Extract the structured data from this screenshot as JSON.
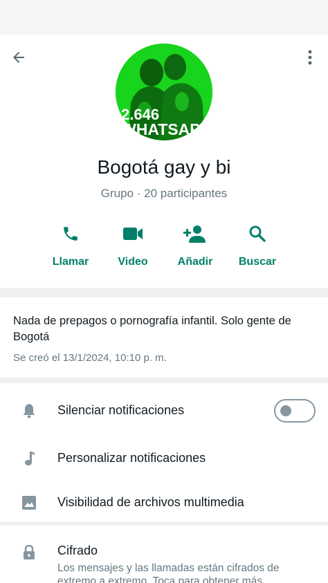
{
  "header": {
    "back_icon": "arrow-left-icon",
    "more_icon": "more-vertical-icon"
  },
  "profile": {
    "name": "Bogotá gay y bi",
    "subtitle": "Grupo · 20 participantes",
    "avatar_text_top": "2.646",
    "avatar_text_bottom": "WHATSAP",
    "avatar_color": "#18d41c"
  },
  "actions": [
    {
      "label": "Llamar",
      "icon": "phone-icon"
    },
    {
      "label": "Video",
      "icon": "video-icon"
    },
    {
      "label": "Añadir",
      "icon": "add-person-icon"
    },
    {
      "label": "Buscar",
      "icon": "search-icon"
    }
  ],
  "description": {
    "text": "Nada de prepagos o pornografía infantil. Solo gente de Bogotá",
    "created": "Se creó el 13/1/2024, 10:10 p. m."
  },
  "settings": [
    {
      "label": "Silenciar notificaciones",
      "icon": "bell-icon",
      "toggle_on": false
    },
    {
      "label": "Personalizar notificaciones",
      "icon": "music-note-icon"
    },
    {
      "label": "Visibilidad de archivos multimedia",
      "icon": "image-icon"
    }
  ],
  "encryption": {
    "title": "Cifrado",
    "subtitle": "Los mensajes y las llamadas están cifrados de extremo a extremo. Toca para obtener más",
    "icon": "lock-icon"
  },
  "colors": {
    "accent": "#008069",
    "secondary_text": "#667781",
    "icon_gray": "#8696a0"
  }
}
